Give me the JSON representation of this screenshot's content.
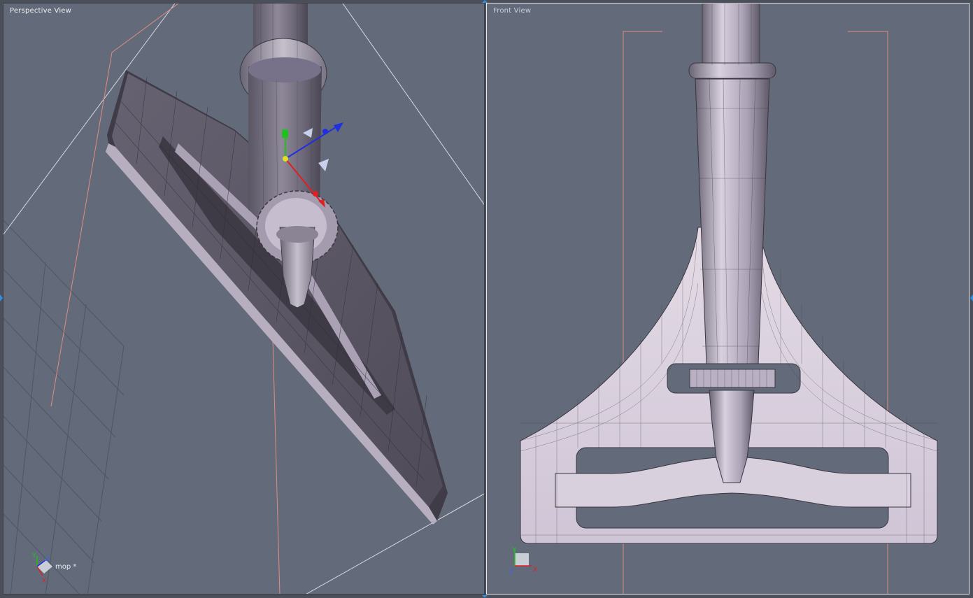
{
  "viewports": {
    "perspective": {
      "title": "Perspective View",
      "object_label": "mop *"
    },
    "front": {
      "title": "Front View"
    }
  },
  "axes": {
    "x": "X",
    "y": "Y",
    "z": "Z"
  },
  "colors": {
    "viewport_bg": "#636b7a",
    "mesh_fill": "#c9bfd0",
    "mesh_shadow": "#5d5966",
    "wire": "#3a3640",
    "bbox_red": "#e08c82",
    "bbox_white": "#e8e8ee",
    "active_border": "#e8e8ee",
    "gizmo_x": "#e02020",
    "gizmo_y": "#20c020",
    "gizmo_z": "#2030e0",
    "gizmo_center": "#e0e020"
  }
}
